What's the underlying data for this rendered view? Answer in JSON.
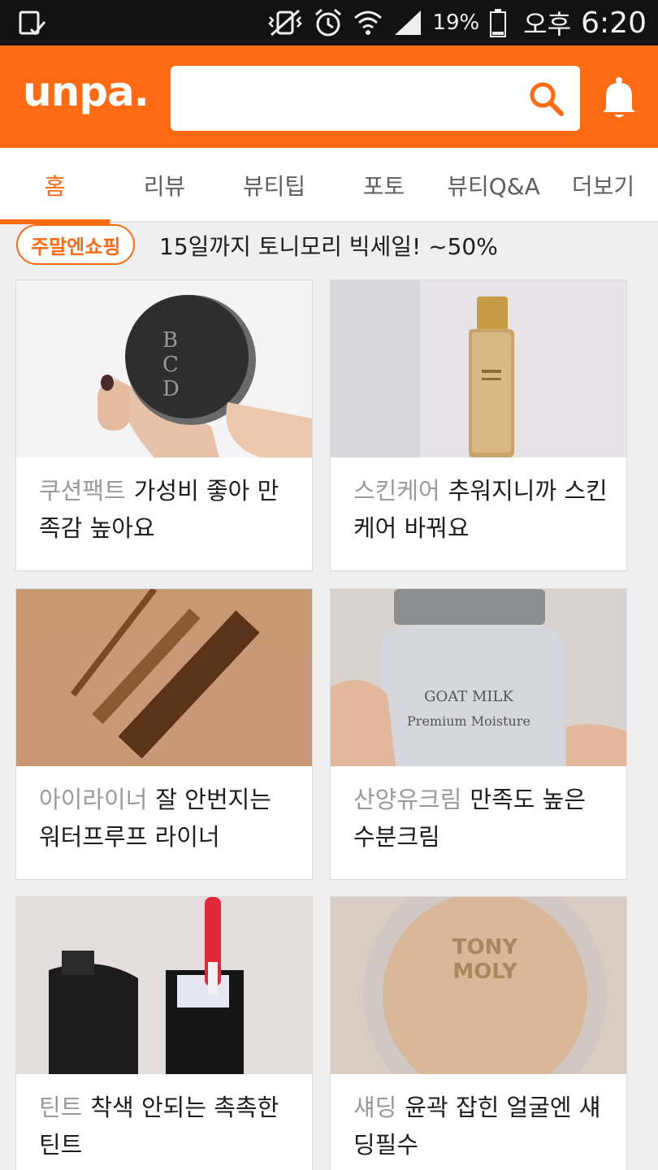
{
  "status_bar": {
    "battery_percent": "19%",
    "ampm": "오후",
    "time": "6:20"
  },
  "header": {
    "logo": "unpa.",
    "search": {
      "value": "",
      "placeholder": ""
    },
    "accent_color": "#ff6a13"
  },
  "tabs": [
    {
      "label": "홈",
      "active": true
    },
    {
      "label": "리뷰",
      "active": false
    },
    {
      "label": "뷰티팁",
      "active": false
    },
    {
      "label": "포토",
      "active": false
    },
    {
      "label": "뷰티Q&A",
      "active": false
    },
    {
      "label": "더보기",
      "active": false
    }
  ],
  "promo": {
    "badge": "주말엔쇼핑",
    "text": "15일까지 토니모리 빅세일! ~50%"
  },
  "cards": [
    {
      "category": "쿠션팩트",
      "title": "가성비 좋아 만족감 높아요"
    },
    {
      "category": "스킨케어",
      "title": "추워지니까 스킨케어 바꿔요"
    },
    {
      "category": "아이라이너",
      "title": "잘 안번지는 워터프루프 라이너"
    },
    {
      "category": "산양유크림",
      "title": "만족도 높은 수분크림"
    },
    {
      "category": "틴트",
      "title": "착색 안되는 촉촉한 틴트"
    },
    {
      "category": "섀딩",
      "title": "윤곽 잡힌 얼굴엔 섀딩필수"
    }
  ]
}
